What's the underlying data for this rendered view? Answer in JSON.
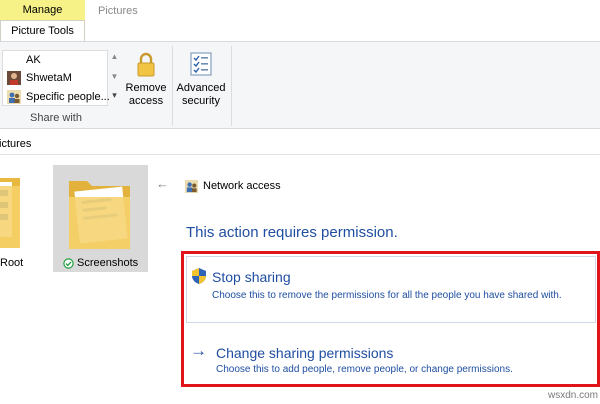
{
  "ribbon": {
    "tab_manage": "Manage",
    "tab_pictures": "Pictures",
    "tab_picture_tools": "Picture Tools",
    "share_with": {
      "items": [
        {
          "label": "AK",
          "icon": "user-icon"
        },
        {
          "label": "ShwetaM",
          "icon": "user-photo-icon"
        },
        {
          "label": "Specific people...",
          "icon": "people-icon"
        }
      ],
      "group_label": "Share with"
    },
    "remove_access_label": "Remove access",
    "remove_access_line1": "Remove",
    "remove_access_line2": "access",
    "advanced_security_line1": "Advanced",
    "advanced_security_line2": "security"
  },
  "address": {
    "path_fragment": "ictures"
  },
  "folders": [
    {
      "label": "Root"
    },
    {
      "label": "Screenshots",
      "status_icon": "sync-ok-icon"
    }
  ],
  "panel": {
    "header": "Network access",
    "heading": "This action requires permission.",
    "options": [
      {
        "title": "Stop sharing",
        "desc": "Choose this to remove the permissions for all the people you have shared with.",
        "icon": "shield-icon"
      },
      {
        "title": "Change sharing permissions",
        "desc": "Choose this to add people, remove people, or change permissions.",
        "icon": "arrow-right-icon"
      }
    ]
  },
  "watermark": "wsxdn.com",
  "colors": {
    "manage_tab": "#f6f288",
    "link_blue": "#1f4ea1",
    "highlight_red": "#e1141b",
    "selection": "#d9d9d9"
  }
}
